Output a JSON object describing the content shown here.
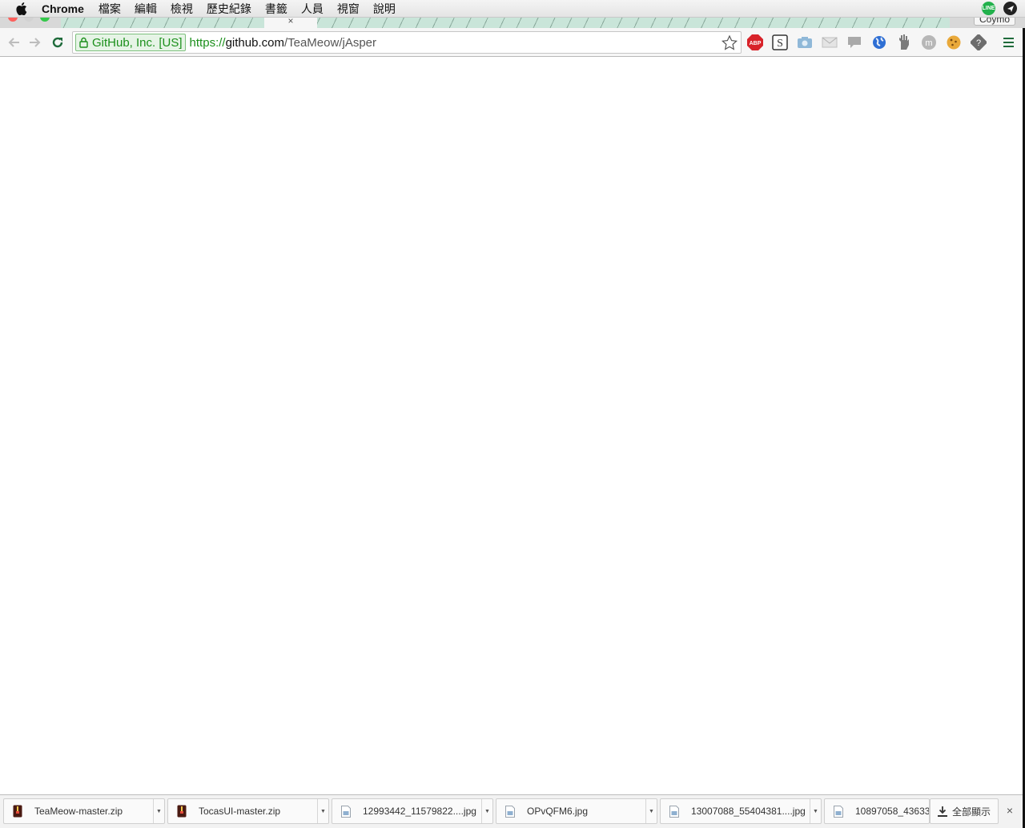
{
  "menubar": {
    "app_name": "Chrome",
    "items": [
      "檔案",
      "編輯",
      "檢視",
      "歷史紀錄",
      "書籤",
      "人員",
      "視窗",
      "說明"
    ],
    "status_icons": [
      "line-icon",
      "telegram-icon"
    ],
    "line_label": "LINE"
  },
  "tabstrip": {
    "active_tab_close": "×",
    "profile_label": "Coymo"
  },
  "toolbar": {
    "ev_label": "GitHub, Inc. [US]",
    "url_scheme": "https://",
    "url_host": "github.com",
    "url_path": "/TeaMeow/jAsper",
    "extensions": [
      "adblock-plus-icon",
      "s-icon",
      "camera-icon",
      "envelope-icon",
      "comment-icon",
      "globe-icon",
      "hand-icon",
      "m-icon",
      "cookie-icon",
      "puzzle-icon"
    ],
    "adblock_label": "ABP",
    "s_label": "S",
    "m_label": "m"
  },
  "colors": {
    "ev_green": "#1b8f1b",
    "reload_green": "#1f6b3b",
    "menubar_bg": "#ececec"
  },
  "downloads": {
    "items": [
      {
        "name": "TeaMeow-master.zip",
        "type": "zip"
      },
      {
        "name": "TocasUI-master.zip",
        "type": "zip"
      },
      {
        "name": "12993442_11579822....jpg",
        "type": "image"
      },
      {
        "name": "OPvQFM6.jpg",
        "type": "image"
      },
      {
        "name": "13007088_55404381....jpg",
        "type": "image"
      },
      {
        "name": "10897058_43633",
        "type": "image"
      }
    ],
    "show_all_label": "全部顯示",
    "close_label": "×"
  }
}
